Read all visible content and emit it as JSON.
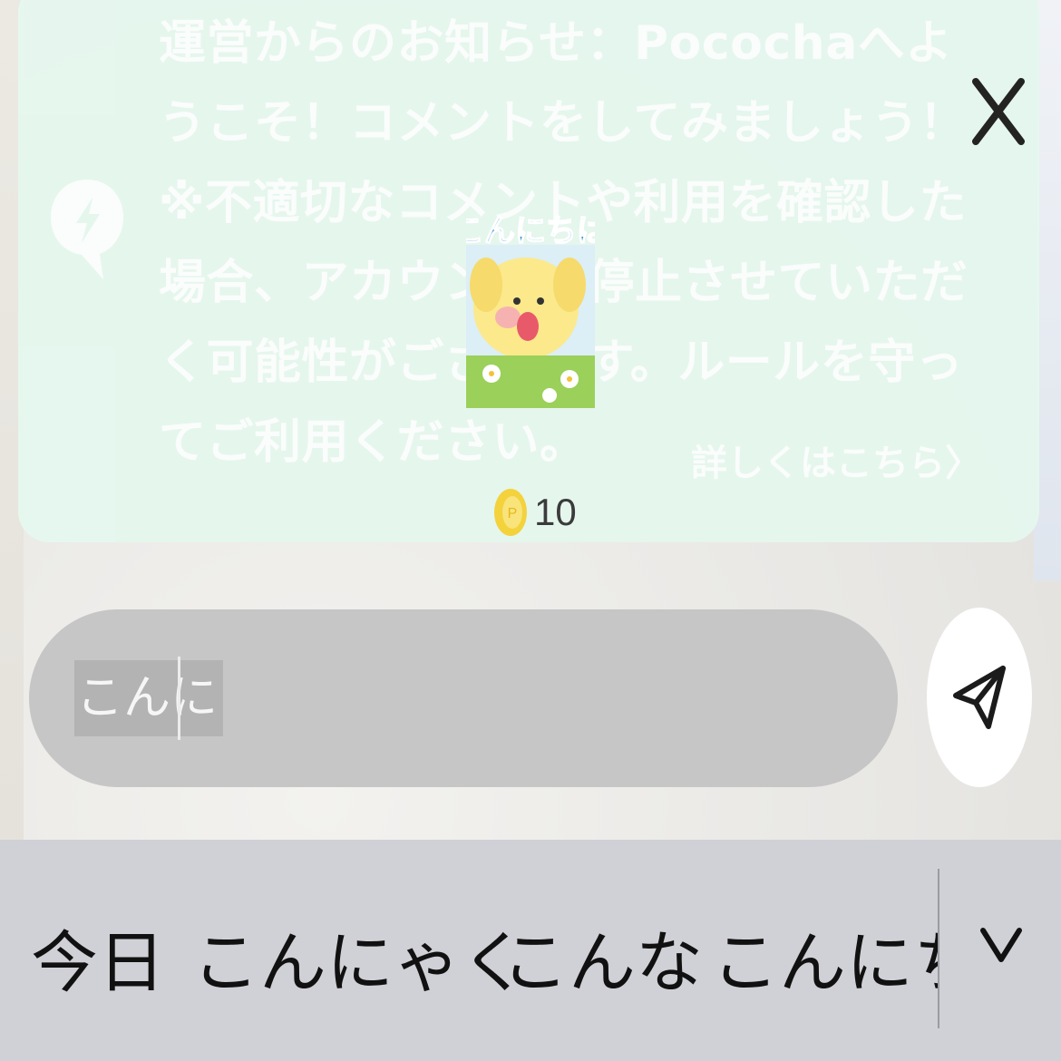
{
  "notice": {
    "text": "運営からのお知らせ：Pocochaへようこそ！コメントをしてみましょう！\n※不適切なコメントや利用を確認した場合、アカウントを停止させていただく可能性がございます。ルールを守ってご利用ください。",
    "details_link": "詳しくはこちら〉",
    "icon": "lightning-bubble-icon",
    "close_icon": "close-icon"
  },
  "sticker": {
    "caption": "こんにちは",
    "price": "10",
    "coin_icon": "coin-icon"
  },
  "comment": {
    "composing_text": "こんに",
    "send_icon": "send-icon"
  },
  "keyboard": {
    "candidates": [
      "今日",
      "こんにゃく",
      "こんな",
      "こんにちは"
    ],
    "expand_icon": "chevron-down-icon"
  },
  "colors": {
    "notice_bg": "#e5f7ee",
    "notice_text": "#fbfefc",
    "input_bg": "#c6c6c6",
    "candidate_bar_bg": "#d0d1d6",
    "coin": "#f3d23c"
  }
}
